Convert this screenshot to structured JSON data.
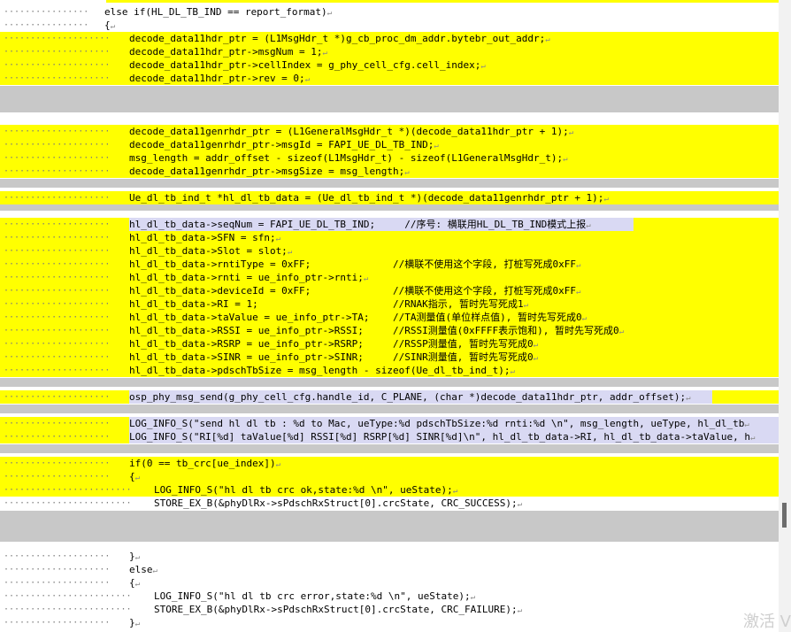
{
  "lines": [
    {
      "indent": 1,
      "text": "else if(HL_DL_TB_IND == report_format)",
      "hl": "none"
    },
    {
      "indent": 1,
      "text": "{",
      "hl": "none"
    },
    {
      "indent": 2,
      "text": "decode_data11hdr_ptr = (L1MsgHdr_t *)g_cb_proc_dm_addr.bytebr_out_addr;",
      "hl": "yellow"
    },
    {
      "indent": 2,
      "text": "decode_data11hdr_ptr->msgNum = 1;",
      "hl": "yellow"
    },
    {
      "indent": 2,
      "text": "decode_data11hdr_ptr->cellIndex = g_phy_cell_cfg.cell_index;",
      "hl": "yellow"
    },
    {
      "indent": 2,
      "text": "decode_data11hdr_ptr->rev = 0;",
      "hl": "yellow"
    },
    {
      "indent": 2,
      "text": "decode_data11genrhdr_ptr = (L1GeneralMsgHdr_t *)(decode_data11hdr_ptr + 1);",
      "hl": "yellow"
    },
    {
      "indent": 2,
      "text": "decode_data11genrhdr_ptr->msgId = FAPI_UE_DL_TB_IND;",
      "hl": "yellow"
    },
    {
      "indent": 2,
      "text": "msg_length = addr_offset - sizeof(L1MsgHdr_t) - sizeof(L1GeneralMsgHdr_t);",
      "hl": "yellow"
    },
    {
      "indent": 2,
      "text": "decode_data11genrhdr_ptr->msgSize = msg_length;",
      "hl": "yellow"
    },
    {
      "indent": 2,
      "text": "Ue_dl_tb_ind_t *hl_dl_tb_data = (Ue_dl_tb_ind_t *)(decode_data11genrhdr_ptr + 1);",
      "hl": "yellow"
    },
    {
      "indent": 2,
      "text": "hl_dl_tb_data->seqNum = FAPI_UE_DL_TB_IND;     //序号: 横联用HL_DL_TB_IND模式上报",
      "hl": "yellow"
    },
    {
      "indent": 2,
      "text": "hl_dl_tb_data->SFN = sfn;",
      "hl": "yellow"
    },
    {
      "indent": 2,
      "text": "hl_dl_tb_data->Slot = slot;",
      "hl": "yellow"
    },
    {
      "indent": 2,
      "text": "hl_dl_tb_data->rntiType = 0xFF;              //横联不使用这个字段, 打桩写死成0xFF",
      "hl": "yellow"
    },
    {
      "indent": 2,
      "text": "hl_dl_tb_data->rnti = ue_info_ptr->rnti;",
      "hl": "yellow"
    },
    {
      "indent": 2,
      "text": "hl_dl_tb_data->deviceId = 0xFF;              //横联不使用这个字段, 打桩写死成0xFF",
      "hl": "yellow"
    },
    {
      "indent": 2,
      "text": "hl_dl_tb_data->RI = 1;                       //RNAK指示, 暂时先写死成1",
      "hl": "yellow"
    },
    {
      "indent": 2,
      "text": "hl_dl_tb_data->taValue = ue_info_ptr->TA;    //TA测量值(单位样点值), 暂时先写死成0",
      "hl": "yellow"
    },
    {
      "indent": 2,
      "text": "hl_dl_tb_data->RSSI = ue_info_ptr->RSSI;     //RSSI测量值(0xFFFF表示饱和), 暂时先写死成0",
      "hl": "yellow"
    },
    {
      "indent": 2,
      "text": "hl_dl_tb_data->RSRP = ue_info_ptr->RSRP;     //RSSP测量值, 暂时先写死成0",
      "hl": "yellow"
    },
    {
      "indent": 2,
      "text": "hl_dl_tb_data->SINR = ue_info_ptr->SINR;     //SINR测量值, 暂时先写死成0",
      "hl": "yellow"
    },
    {
      "indent": 2,
      "text": "hl_dl_tb_data->pdschTbSize = msg_length - sizeof(Ue_dl_tb_ind_t);",
      "hl": "yellow"
    },
    {
      "indent": 2,
      "text": "osp_phy_msg_send(g_phy_cell_cfg.handle_id, C_PLANE, (char *)decode_data11hdr_ptr, addr_offset);",
      "hl": "yellow"
    },
    {
      "indent": 2,
      "text": "LOG_INFO_S(\"send hl dl tb : %d to Mac, ueType:%d pdschTbSize:%d rnti:%d \\n\", msg_length, ueType, hl_dl_tb",
      "hl": "yellow"
    },
    {
      "indent": 2,
      "text": "LOG_INFO_S(\"RI[%d] taValue[%d] RSSI[%d] RSRP[%d] SINR[%d]\\n\", hl_dl_tb_data->RI, hl_dl_tb_data->taValue, h",
      "hl": "yellow"
    },
    {
      "indent": 2,
      "text": "if(0 == tb_crc[ue_index])",
      "hl": "yellow"
    },
    {
      "indent": 2,
      "text": "{",
      "hl": "yellow"
    },
    {
      "indent": 3,
      "text": "LOG_INFO_S(\"hl dl tb crc ok,state:%d \\n\", ueState);",
      "hl": "yellow"
    },
    {
      "indent": 3,
      "text": "STORE_EX_B(&phyDlRx->sPdschRxStruct[0].crcState, CRC_SUCCESS);",
      "hl": "none"
    },
    {
      "indent": 2,
      "text": "}",
      "hl": "none"
    },
    {
      "indent": 2,
      "text": "else",
      "hl": "none"
    },
    {
      "indent": 2,
      "text": "{",
      "hl": "none"
    },
    {
      "indent": 3,
      "text": "LOG_INFO_S(\"hl dl tb crc error,state:%d \\n\", ueState);",
      "hl": "none"
    },
    {
      "indent": 3,
      "text": "STORE_EX_B(&phyDlRx->sPdschRxStruct[0].crcState, CRC_FAILURE);",
      "hl": "none"
    },
    {
      "indent": 2,
      "text": "}",
      "hl": "none"
    }
  ],
  "paragraph_mark": "↵",
  "watermark": "激活 V"
}
